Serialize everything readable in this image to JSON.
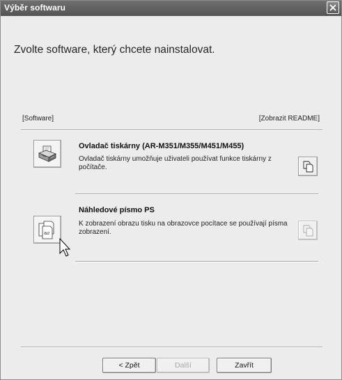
{
  "window": {
    "title": "Výběr softwaru"
  },
  "heading": "Zvolte software, který chcete nainstalovat.",
  "list_header": {
    "left": "[Software]",
    "right": "[Zobrazit README]"
  },
  "items": [
    {
      "title": "Ovladač tiskárny (AR-M351/M355/M451/M455)",
      "description": "Ovladač tiskárny umožňuje uživateli používat funkce tiskárny z počítače.",
      "icon": "printer-icon",
      "readme_enabled": true
    },
    {
      "title": "Náhledové písmo PS",
      "description": "K zobrazení obrazu tisku na obrazovce pocítace se používají písma zobrazení.",
      "icon": "font-files-icon",
      "readme_enabled": false
    }
  ],
  "buttons": {
    "back": "< Zpět",
    "next": "Další",
    "close": "Zavřít"
  },
  "colors": {
    "titlebar": "#5f5f5f",
    "window_bg": "#ececec"
  }
}
